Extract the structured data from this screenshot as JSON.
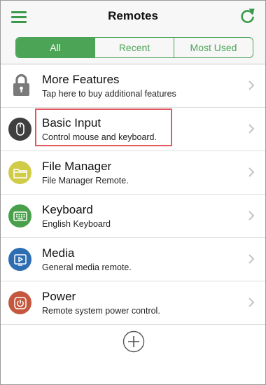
{
  "header": {
    "title": "Remotes",
    "tabs": [
      {
        "label": "All",
        "active": true
      },
      {
        "label": "Recent",
        "active": false
      },
      {
        "label": "Most Used",
        "active": false
      }
    ]
  },
  "remotes": [
    {
      "name": "More Features",
      "description": "Tap here to buy additional features",
      "icon": "lock-icon",
      "color": ""
    },
    {
      "name": "Basic Input",
      "description": "Control mouse and keyboard.",
      "icon": "mouse-icon",
      "color": "#3f3f3f"
    },
    {
      "name": "File Manager",
      "description": "File Manager Remote.",
      "icon": "folder-icon",
      "color": "#d1cc47"
    },
    {
      "name": "Keyboard",
      "description": "English Keyboard",
      "icon": "keyboard-icon",
      "color": "#49a04a"
    },
    {
      "name": "Media",
      "description": "General media remote.",
      "icon": "media-icon",
      "color": "#2d6db2"
    },
    {
      "name": "Power",
      "description": "Remote system power control.",
      "icon": "power-icon",
      "color": "#c4573e"
    }
  ],
  "colors": {
    "accent": "#4ca456",
    "highlight": "#e05a60"
  }
}
